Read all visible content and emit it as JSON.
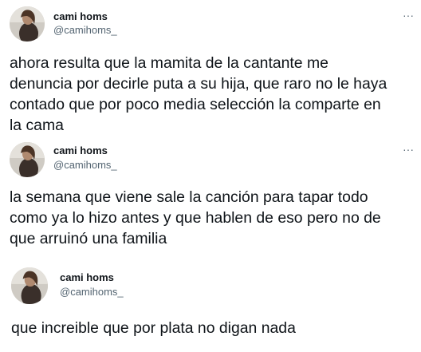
{
  "tweets": [
    {
      "author": {
        "name": "cami homs",
        "handle": "@camihoms_"
      },
      "show_more": true,
      "more_icon": "ellipsis-icon",
      "lines": [
        "ahora resulta que la mamita de la cantante me",
        "denuncia por decirle puta a su hija, que raro no le haya",
        "contado que por poco media selección la comparte en",
        "la cama"
      ]
    },
    {
      "author": {
        "name": "cami homs",
        "handle": "@camihoms_"
      },
      "show_more": true,
      "more_icon": "ellipsis-icon",
      "lines": [
        "la semana que viene sale la canción para tapar todo",
        "como ya lo hizo antes y que hablen de eso pero no de",
        "que arruinó una familia"
      ]
    },
    {
      "author": {
        "name": "cami homs",
        "handle": "@camihoms_"
      },
      "show_more": false,
      "lines": [
        "que increible que por plata no digan nada"
      ]
    }
  ],
  "ui": {
    "more_glyph": "···"
  }
}
